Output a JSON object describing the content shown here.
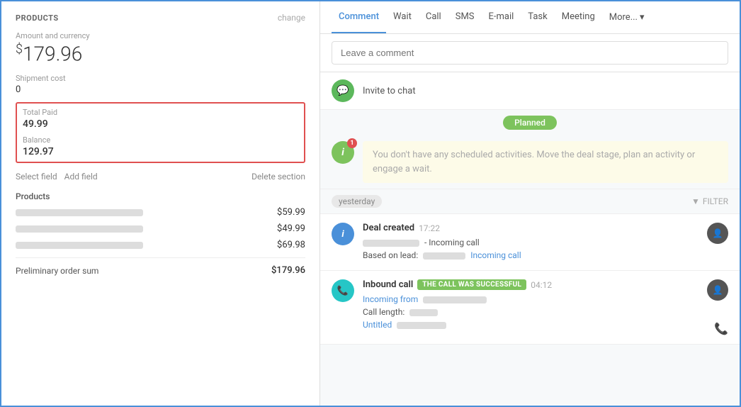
{
  "left": {
    "products_title": "PRODUCTS",
    "change_label": "change",
    "amount_label": "Amount and currency",
    "amount_currency": "$",
    "amount_value": "179.96",
    "shipment_label": "Shipment cost",
    "shipment_value": "0",
    "total_paid_label": "Total Paid",
    "total_paid_value": "49.99",
    "balance_label": "Balance",
    "balance_value": "129.97",
    "select_field_label": "Select field",
    "add_field_label": "Add field",
    "delete_section_label": "Delete section",
    "products_section": "Products",
    "product1_price": "$59.99",
    "product2_price": "$49.99",
    "product3_price": "$69.98",
    "preliminary_label": "Preliminary order sum",
    "preliminary_value": "$179.96"
  },
  "right": {
    "tabs": [
      {
        "id": "comment",
        "label": "Comment",
        "active": true
      },
      {
        "id": "wait",
        "label": "Wait",
        "active": false
      },
      {
        "id": "call",
        "label": "Call",
        "active": false
      },
      {
        "id": "sms",
        "label": "SMS",
        "active": false
      },
      {
        "id": "email",
        "label": "E-mail",
        "active": false
      },
      {
        "id": "task",
        "label": "Task",
        "active": false
      },
      {
        "id": "meeting",
        "label": "Meeting",
        "active": false
      }
    ],
    "more_label": "More...",
    "comment_placeholder": "Leave a comment",
    "invite_text": "Invite to chat",
    "planned_badge": "Planned",
    "scheduled_notice": "You don't have any scheduled activities. Move the deal stage, plan an activity or engage a wait.",
    "yesterday_label": "yesterday",
    "filter_label": "FILTER",
    "deal_created_title": "Deal created",
    "deal_created_time": "17:22",
    "deal_incoming_label": "- Incoming call",
    "deal_based_label": "Based on lead:",
    "deal_incoming_link": "Incoming call",
    "inbound_call_title": "Inbound call",
    "call_badge_text": "THE CALL WAS SUCCESSFUL",
    "call_time": "04:12",
    "incoming_from_label": "Incoming from",
    "call_length_label": "Call length:",
    "untitled_label": "Untitled"
  }
}
